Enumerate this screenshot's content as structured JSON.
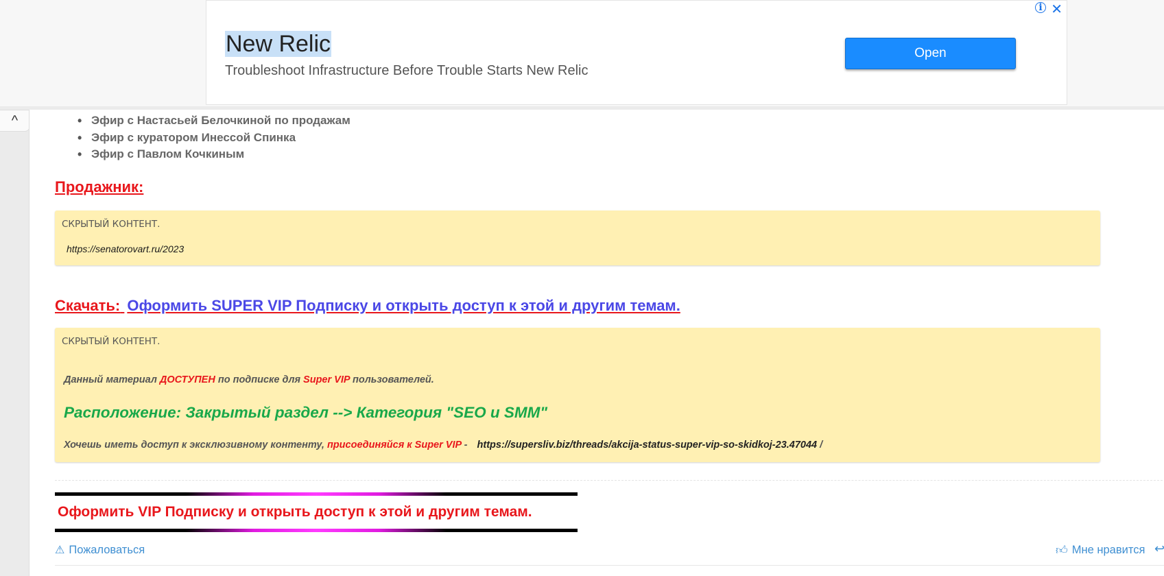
{
  "ad": {
    "title": "New Relic",
    "subtitle": "Troubleshoot Infrastructure Before Trouble Starts New Relic",
    "button": "Open",
    "info_icon": "info-icon",
    "close_icon": "close-icon",
    "accent": "#1a8cff"
  },
  "scroll_tab": {
    "icon": "chevron-up-icon",
    "glyph": "^"
  },
  "list": {
    "items": [
      "Эфир с Настасьей Белочкиной по продажам",
      "Эфир с куратором Инессой Спинка",
      "Эфир с Павлом Кочкиным"
    ]
  },
  "seller": {
    "heading": "Продажник:",
    "hidden_label": "СКРЫТЫЙ КОНТЕНТ.",
    "url": "https://senatorovart.ru/2023"
  },
  "download": {
    "heading": "Скачать:",
    "link": "Оформить SUPER VIP Подписку и открыть доступ к этой и другим темам.",
    "hidden_label": "СКРЫТЫЙ КОНТЕНТ.",
    "line1_a": "Данный материал ",
    "line1_b": "ДОСТУПЕН",
    "line1_c": " по подписке для ",
    "line1_d": "Super VIP",
    "line1_e": " пользователей.",
    "location": "Расположение: Закрытый раздел --> Категория \"SEO и SMM\"",
    "line3_a": "Хочешь иметь доступ к эксклюзивному контенту, ",
    "line3_b": "присоединяйся к Super VIP",
    "line3_c": " - ",
    "line3_url": "https://supersliv.biz/threads/akcija-status-super-vip-so-skidkoj-23.47044",
    "line3_d": " /"
  },
  "vip_banner": {
    "text": "Оформить VIP Подписку и открыть доступ к этой и другим темам."
  },
  "actions": {
    "report": "Пожаловаться",
    "report_icon": "warning-icon",
    "like": "Мне нравится",
    "like_icon": "thumbs-up-icon",
    "reply_icon": "reply-icon"
  },
  "colors": {
    "red": "#e8171c",
    "green": "#19a84a",
    "link_blue": "#4b48e6",
    "action_blue": "#3f8fd2",
    "hidden_bg": "#fff0b3"
  }
}
